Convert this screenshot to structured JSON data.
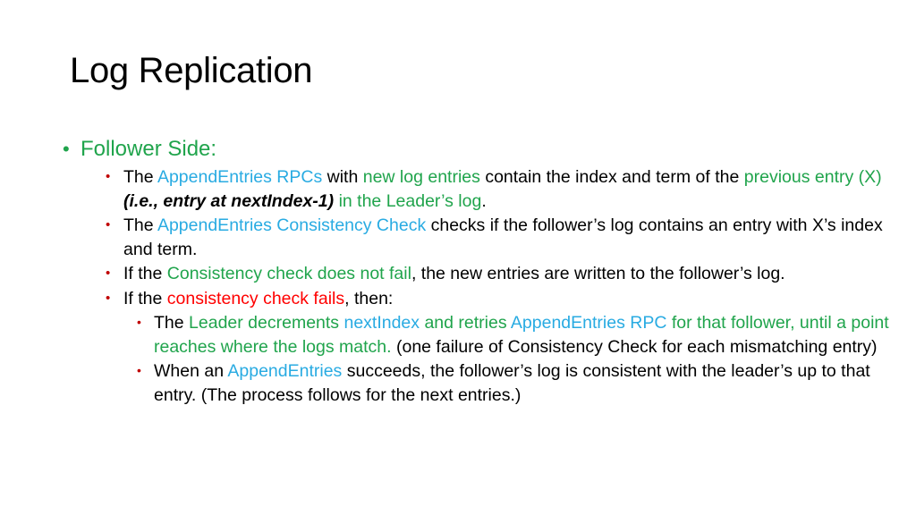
{
  "slide": {
    "title": "Log Replication",
    "colors": {
      "green": "#20A44C",
      "blue": "#29ABE2",
      "red": "#FF0000",
      "dark_red_bullet": "#C00000",
      "black": "#000000",
      "background": "#FFFFFF"
    },
    "bullet_glyph_level1": "•",
    "bullet_glyph_level2": "•",
    "bullet_glyph_level3": "•",
    "heading": {
      "label": "Follower Side:"
    },
    "items": [
      {
        "id": "append-entries-rpcs",
        "runs": [
          {
            "text": "The ",
            "color": "black"
          },
          {
            "text": "AppendEntries RPCs",
            "color": "blue"
          },
          {
            "text": " with ",
            "color": "black"
          },
          {
            "text": "new log entries",
            "color": "green"
          },
          {
            "text": " contain the index and term of the ",
            "color": "black"
          },
          {
            "text": "previous entry (X)",
            "color": "green"
          },
          {
            "text": " ",
            "color": "black"
          },
          {
            "text": "(i.e., entry at nextIndex-1)",
            "color": "black",
            "style": "bold-italic"
          },
          {
            "text": " ",
            "color": "black"
          },
          {
            "text": "in the Leader’s log",
            "color": "green"
          },
          {
            "text": ".",
            "color": "black"
          }
        ]
      },
      {
        "id": "consistency-check",
        "runs": [
          {
            "text": "The ",
            "color": "black"
          },
          {
            "text": "AppendEntries Consistency Check",
            "color": "blue"
          },
          {
            "text": " checks if the follower’s log contains an entry with X’s index and term.",
            "color": "black"
          }
        ]
      },
      {
        "id": "check-does-not-fail",
        "runs": [
          {
            "text": "If the ",
            "color": "black"
          },
          {
            "text": "Consistency check does not fail",
            "color": "green"
          },
          {
            "text": ", the new entries are written to the follower’s log.",
            "color": "black"
          }
        ]
      },
      {
        "id": "check-fails",
        "runs": [
          {
            "text": "If the ",
            "color": "black"
          },
          {
            "text": "consistency check fails",
            "color": "red"
          },
          {
            "text": ", then:",
            "color": "black"
          }
        ]
      }
    ],
    "subitems": [
      {
        "id": "leader-decrements-nextindex",
        "runs": [
          {
            "text": "The ",
            "color": "black"
          },
          {
            "text": "Leader decrements ",
            "color": "green"
          },
          {
            "text": "nextIndex",
            "color": "blue"
          },
          {
            "text": " and retries ",
            "color": "green"
          },
          {
            "text": "AppendEntries RPC",
            "color": "blue"
          },
          {
            "text": " for that follower, until a point reaches where the logs match.",
            "color": "green"
          },
          {
            "text": " (one failure of Consistency Check for each mismatching entry)",
            "color": "black"
          }
        ]
      },
      {
        "id": "append-entries-succeeds",
        "runs": [
          {
            "text": " When an ",
            "color": "black"
          },
          {
            "text": "AppendEntries",
            "color": "blue"
          },
          {
            "text": " succeeds, the follower’s log is consistent with the leader’s up to that entry. (The process follows for the next entries.)",
            "color": "black"
          }
        ]
      }
    ]
  }
}
